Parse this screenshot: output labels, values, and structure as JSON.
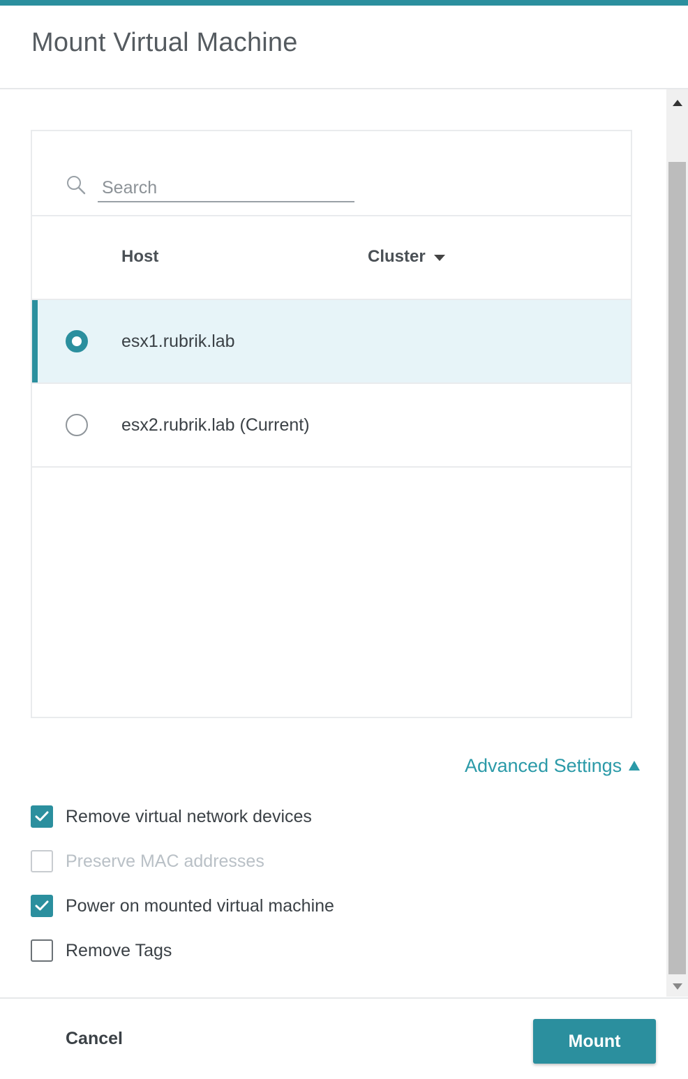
{
  "dialog": {
    "title": "Mount Virtual Machine"
  },
  "search": {
    "placeholder": "Search",
    "value": ""
  },
  "table": {
    "columns": [
      "Host",
      "Cluster"
    ],
    "rows": [
      {
        "host": "esx1.rubrik.lab",
        "selected": true
      },
      {
        "host": "esx2.rubrik.lab (Current)",
        "selected": false
      }
    ]
  },
  "advanced": {
    "label": "Advanced Settings",
    "options": [
      {
        "label": "Remove virtual network devices",
        "checked": true,
        "disabled": false
      },
      {
        "label": "Preserve MAC addresses",
        "checked": false,
        "disabled": true
      },
      {
        "label": "Power on mounted virtual machine",
        "checked": true,
        "disabled": false
      },
      {
        "label": "Remove Tags",
        "checked": false,
        "disabled": false
      }
    ]
  },
  "footer": {
    "cancel_label": "Cancel",
    "mount_label": "Mount"
  },
  "colors": {
    "accent": "#2b8f9e",
    "link": "#2b9aa8",
    "selected_row_bg": "#e7f4f8"
  },
  "icons": {
    "search": "search-icon",
    "sort": "sort-descending-icon",
    "advanced_toggle": "caret-up-icon",
    "check": "checkmark-icon",
    "scroll_up": "scroll-up-arrow-icon",
    "scroll_down": "scroll-down-arrow-icon"
  }
}
